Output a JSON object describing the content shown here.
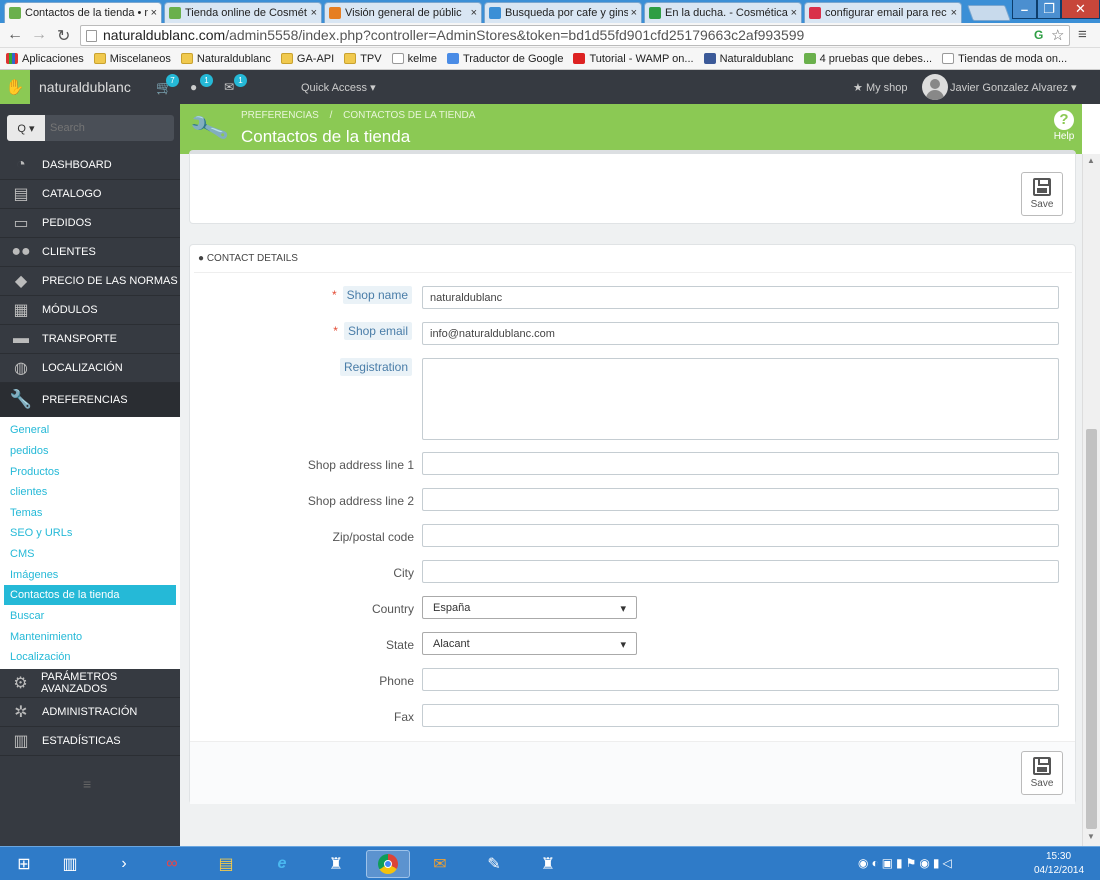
{
  "browser": {
    "tabs": [
      {
        "title": "Contactos de la tienda • n",
        "active": true,
        "fav": "#6ab04c"
      },
      {
        "title": "Tienda online de Cosmét",
        "active": false,
        "fav": "#6ab04c"
      },
      {
        "title": "Visión general de públic",
        "active": false,
        "fav": "#e67e22"
      },
      {
        "title": "Busqueda por cafe y ginseng",
        "active": false,
        "fav": "#3a8fd6"
      },
      {
        "title": "En la ducha. - Cosmética",
        "active": false,
        "fav": "#2e9e44"
      },
      {
        "title": "configurar email para rec",
        "active": false,
        "fav": "#d9304a"
      }
    ],
    "tab_close": "×",
    "url_domain": "naturaldublanc.com",
    "url_path": "/admin5558/index.php?controller=AdminStores&token=bd1d55fd901cfd25179663c2af993599",
    "bookmarks": [
      {
        "label": "Aplicaciones",
        "icon": "apps-icon"
      },
      {
        "label": "Miscelaneos",
        "icon": "folder-icon"
      },
      {
        "label": "Naturaldublanc",
        "icon": "folder-icon"
      },
      {
        "label": "GA-API",
        "icon": "folder-icon"
      },
      {
        "label": "TPV",
        "icon": "folder-icon"
      },
      {
        "label": "kelme",
        "icon": "page-icon"
      },
      {
        "label": "Traductor de Google",
        "icon": "translate-icon"
      },
      {
        "label": "Tutorial - WAMP on...",
        "icon": "youtube-icon"
      },
      {
        "label": "Naturaldublanc",
        "icon": "facebook-icon"
      },
      {
        "label": "4 pruebas que debes...",
        "icon": "leaf-icon"
      },
      {
        "label": "Tiendas de moda on...",
        "icon": "page-icon"
      }
    ]
  },
  "admin_header": {
    "shop_name": "naturaldublanc",
    "cart_count": "7",
    "user_count": "1",
    "mail_count": "1",
    "quick_access": "Quick Access",
    "my_shop": "My shop",
    "employee": "Javier Gonzalez Alvarez"
  },
  "sidebar": {
    "search_placeholder": "Search",
    "search_btn": "Q ▾",
    "menu": [
      {
        "label": "DASHBOARD",
        "icon": "dashboard-icon"
      },
      {
        "label": "CATALOGO",
        "icon": "catalog-icon"
      },
      {
        "label": "PEDIDOS",
        "icon": "orders-icon"
      },
      {
        "label": "CLIENTES",
        "icon": "customers-icon"
      },
      {
        "label": "PRECIO DE LAS NORMAS",
        "icon": "price-rules-icon"
      },
      {
        "label": "MÓDULOS",
        "icon": "modules-icon"
      },
      {
        "label": "TRANSPORTE",
        "icon": "shipping-icon"
      },
      {
        "label": "LOCALIZACIÓN",
        "icon": "globe-icon"
      },
      {
        "label": "PREFERENCIAS",
        "icon": "wrench-icon"
      }
    ],
    "submenu": [
      "General",
      "pedidos",
      "Productos",
      "clientes",
      "Temas",
      "SEO y URLs",
      "CMS",
      "Imágenes",
      "Contactos de la tienda",
      "Buscar",
      "Mantenimiento",
      "Localización"
    ],
    "submenu_active": "Contactos de la tienda",
    "menu_bottom": [
      {
        "label": "PARÁMETROS AVANZADOS",
        "icon": "gears-icon"
      },
      {
        "label": "ADMINISTRACIÓN",
        "icon": "cog-icon"
      },
      {
        "label": "ESTADÍSTICAS",
        "icon": "stats-icon"
      }
    ],
    "collapse": "≡"
  },
  "page": {
    "breadcrumb_parent": "PREFERENCIAS",
    "breadcrumb_sep": "/",
    "breadcrumb_current": "CONTACTOS DE LA TIENDA",
    "title": "Contactos de la tienda",
    "help": "Help"
  },
  "form": {
    "save_label": "Save",
    "section_title": "CONTACT DETAILS",
    "fields": {
      "shop_name": {
        "label": "Shop name",
        "value": "naturaldublanc",
        "required": true
      },
      "shop_email": {
        "label": "Shop email",
        "value": "info@naturaldublanc.com",
        "required": true
      },
      "registration": {
        "label": "Registration",
        "value": ""
      },
      "address1": {
        "label": "Shop address line 1",
        "value": ""
      },
      "address2": {
        "label": "Shop address line 2",
        "value": ""
      },
      "zip": {
        "label": "Zip/postal code",
        "value": ""
      },
      "city": {
        "label": "City",
        "value": ""
      },
      "country": {
        "label": "Country",
        "value": "España"
      },
      "state": {
        "label": "State",
        "value": "Alacant"
      },
      "phone": {
        "label": "Phone",
        "value": ""
      },
      "fax": {
        "label": "Fax",
        "value": ""
      }
    },
    "required_mark": "*"
  },
  "taskbar": {
    "time": "15:30",
    "date": "04/12/2014"
  },
  "colors": {
    "accent": "#25b9d7",
    "header_green": "#8bc954",
    "sidebar": "#363a41"
  }
}
